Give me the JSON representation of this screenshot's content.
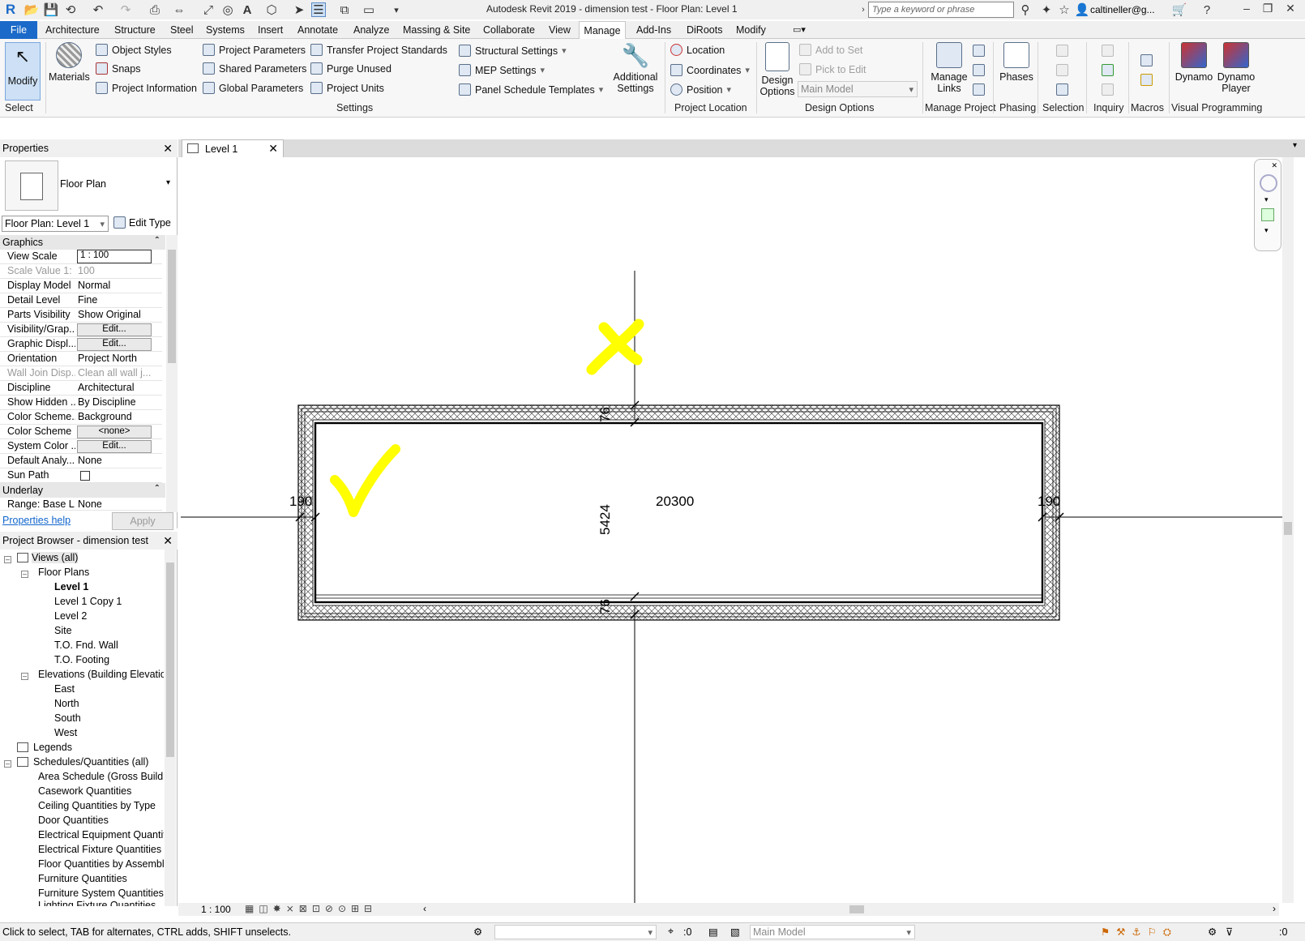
{
  "titlebar": {
    "title": "Autodesk Revit 2019 - dimension test - Floor Plan: Level 1",
    "search_placeholder": "Type a keyword or phrase",
    "user": "caltineller@g..."
  },
  "ribbon_tabs": [
    "File",
    "Architecture",
    "Structure",
    "Steel",
    "Systems",
    "Insert",
    "Annotate",
    "Analyze",
    "Massing & Site",
    "Collaborate",
    "View",
    "Manage",
    "Add-Ins",
    "DiRoots",
    "Modify"
  ],
  "ribbon": {
    "modify": "Modify",
    "select": "Select",
    "materials": "Materials",
    "object_styles": "Object  Styles",
    "snaps": "Snaps",
    "project_information": "Project  Information",
    "project_parameters": "Project  Parameters",
    "shared_parameters": "Shared  Parameters",
    "global_parameters": "Global  Parameters",
    "transfer_standards": "Transfer  Project Standards",
    "purge_unused": "Purge  Unused",
    "project_units": "Project  Units",
    "settings_title": "Settings",
    "structural_settings": "Structural  Settings",
    "mep_settings": "MEP  Settings",
    "panel_schedule_templates": "Panel Schedule  Templates",
    "additional_settings_1": "Additional",
    "additional_settings_2": "Settings",
    "location": "Location",
    "coordinates": "Coordinates",
    "position": "Position",
    "project_location_title": "Project Location",
    "design_options_1": "Design",
    "design_options_2": "Options",
    "add_to_set": "Add to Set",
    "pick_to_edit": "Pick to Edit",
    "main_model": "Main Model",
    "design_options_title": "Design Options",
    "manage_links_1": "Manage",
    "manage_links_2": "Links",
    "manage_project_title": "Manage Project",
    "phases": "Phases",
    "phasing_title": "Phasing",
    "selection_title": "Selection",
    "inquiry_title": "Inquiry",
    "macros_title": "Macros",
    "dynamo": "Dynamo",
    "dynamo_player_1": "Dynamo",
    "dynamo_player_2": "Player",
    "visual_programming_title": "Visual Programming"
  },
  "properties": {
    "title": "Properties",
    "type_name": "Floor Plan",
    "instance": "Floor Plan: Level 1",
    "edit_type": "Edit Type",
    "section_graphics": "Graphics",
    "rows": [
      {
        "k": "View Scale",
        "v": "1 : 100"
      },
      {
        "k": "Scale Value    1:",
        "v": "100"
      },
      {
        "k": "Display Model",
        "v": "Normal"
      },
      {
        "k": "Detail Level",
        "v": "Fine"
      },
      {
        "k": "Parts Visibility",
        "v": "Show Original"
      },
      {
        "k": "Visibility/Grap...",
        "v": "Edit..."
      },
      {
        "k": "Graphic Displ...",
        "v": "Edit..."
      },
      {
        "k": "Orientation",
        "v": "Project North"
      },
      {
        "k": "Wall Join Disp...",
        "v": "Clean all wall j..."
      },
      {
        "k": "Discipline",
        "v": "Architectural"
      },
      {
        "k": "Show Hidden ...",
        "v": "By Discipline"
      },
      {
        "k": "Color Scheme...",
        "v": "Background"
      },
      {
        "k": "Color Scheme",
        "v": "<none>"
      },
      {
        "k": "System Color ...",
        "v": "Edit..."
      },
      {
        "k": "Default Analy...",
        "v": "None"
      },
      {
        "k": "Sun Path",
        "v": ""
      }
    ],
    "section_underlay": "Underlay",
    "underlay_row": {
      "k": "Range: Base L...",
      "v": "None"
    },
    "help": "Properties help",
    "apply": "Apply"
  },
  "browser": {
    "title": "Project Browser - dimension test",
    "nodes": [
      "Views (all)",
      "Floor Plans",
      "Level 1",
      "Level 1 Copy 1",
      "Level 2",
      "Site",
      "T.O. Fnd. Wall",
      "T.O. Footing",
      "Elevations (Building Elevation",
      "East",
      "North",
      "South",
      "West",
      "Legends",
      "Schedules/Quantities (all)",
      "Area Schedule (Gross Building",
      "Casework Quantities",
      "Ceiling Quantities by Type",
      "Door Quantities",
      "Electrical Equipment Quantiti",
      "Electrical Fixture Quantities",
      "Floor Quantities by Assembly",
      "Furniture Quantities",
      "Furniture System Quantities",
      "Lighting Fixture Quantities"
    ]
  },
  "view_tab": "Level 1",
  "drawing": {
    "dim_top": "76",
    "dim_bottom": "76",
    "dim_left": "190",
    "dim_right": "190",
    "dim_height": "5424",
    "dim_length": "20300",
    "mark_x": "X",
    "mark_check": "✓",
    "wall_color": "#000000",
    "mark_color": "#ffff00"
  },
  "view_control": {
    "scale": "1 : 100"
  },
  "statusbar": {
    "text": "Click to select, TAB for alternates, CTRL adds, SHIFT unselects.",
    "sel_count": ":0",
    "design_option": "Main Model",
    "filter_count": ":0"
  },
  "colors": {
    "file_tab": "#1b6ac9",
    "link": "#1166cc"
  }
}
